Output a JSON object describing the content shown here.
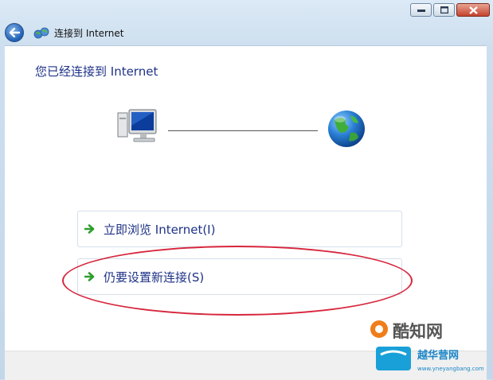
{
  "window": {
    "title": "连接到 Internet",
    "buttons": [
      "minimize",
      "maximize",
      "close"
    ]
  },
  "content": {
    "heading": "您已经连接到 Internet",
    "diagram": {
      "left_icon": "computer-icon",
      "right_icon": "globe-icon"
    },
    "options": [
      {
        "label": "立即浏览 Internet(I)",
        "icon": "green-arrow-icon"
      },
      {
        "label": "仍要设置新连接(S)",
        "icon": "green-arrow-icon",
        "annotated": true
      }
    ]
  },
  "watermark": {
    "brand": "酷知网",
    "sub": "越华营网",
    "url": "www.yneyangbang.com"
  },
  "colors": {
    "link": "#1e3287",
    "annotation": "#d7263d",
    "arrow": "#2e9e2e"
  }
}
